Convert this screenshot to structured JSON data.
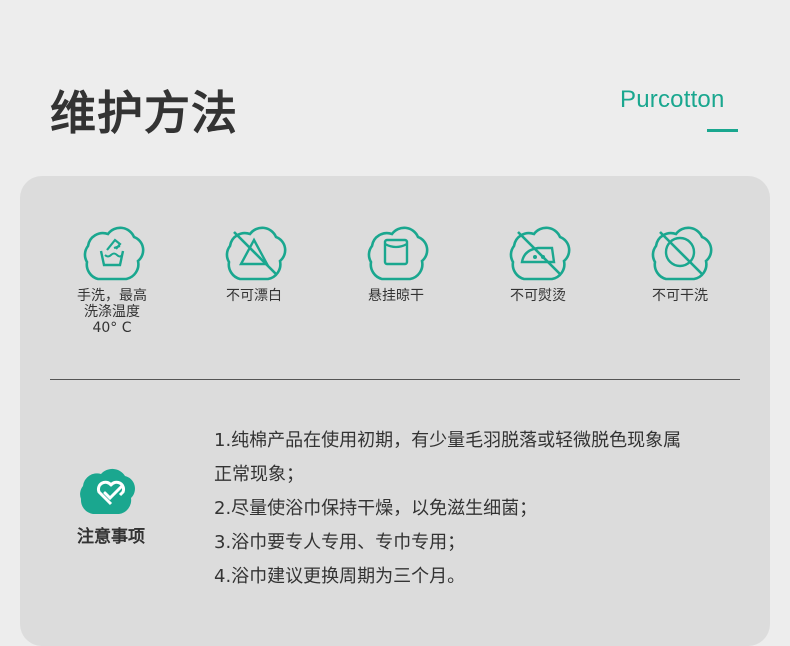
{
  "header": {
    "title": "维护方法",
    "brand": "Purcotton"
  },
  "colors": {
    "accent": "#1aa78f",
    "panel": "#dcdcdc",
    "background": "#ededed"
  },
  "care_icons": [
    {
      "icon": "hand-wash-icon",
      "label_lines": [
        "手洗，最高",
        "洗涤温度",
        "40° C"
      ]
    },
    {
      "icon": "no-bleach-icon",
      "label_lines": [
        "不可漂白"
      ]
    },
    {
      "icon": "hang-dry-icon",
      "label_lines": [
        "悬挂晾干"
      ]
    },
    {
      "icon": "no-iron-icon",
      "label_lines": [
        "不可熨烫"
      ]
    },
    {
      "icon": "no-dry-clean-icon",
      "label_lines": [
        "不可干洗"
      ]
    }
  ],
  "notes": {
    "title": "注意事项",
    "icon": "heart-check-icon",
    "lines": [
      "1.纯棉产品在使用初期，有少量毛羽脱落或轻微脱色现象属",
      "正常现象；",
      "2.尽量使浴巾保持干燥，以免滋生细菌；",
      "3.浴巾要专人专用、专巾专用；",
      "4.浴巾建议更换周期为三个月。"
    ]
  }
}
